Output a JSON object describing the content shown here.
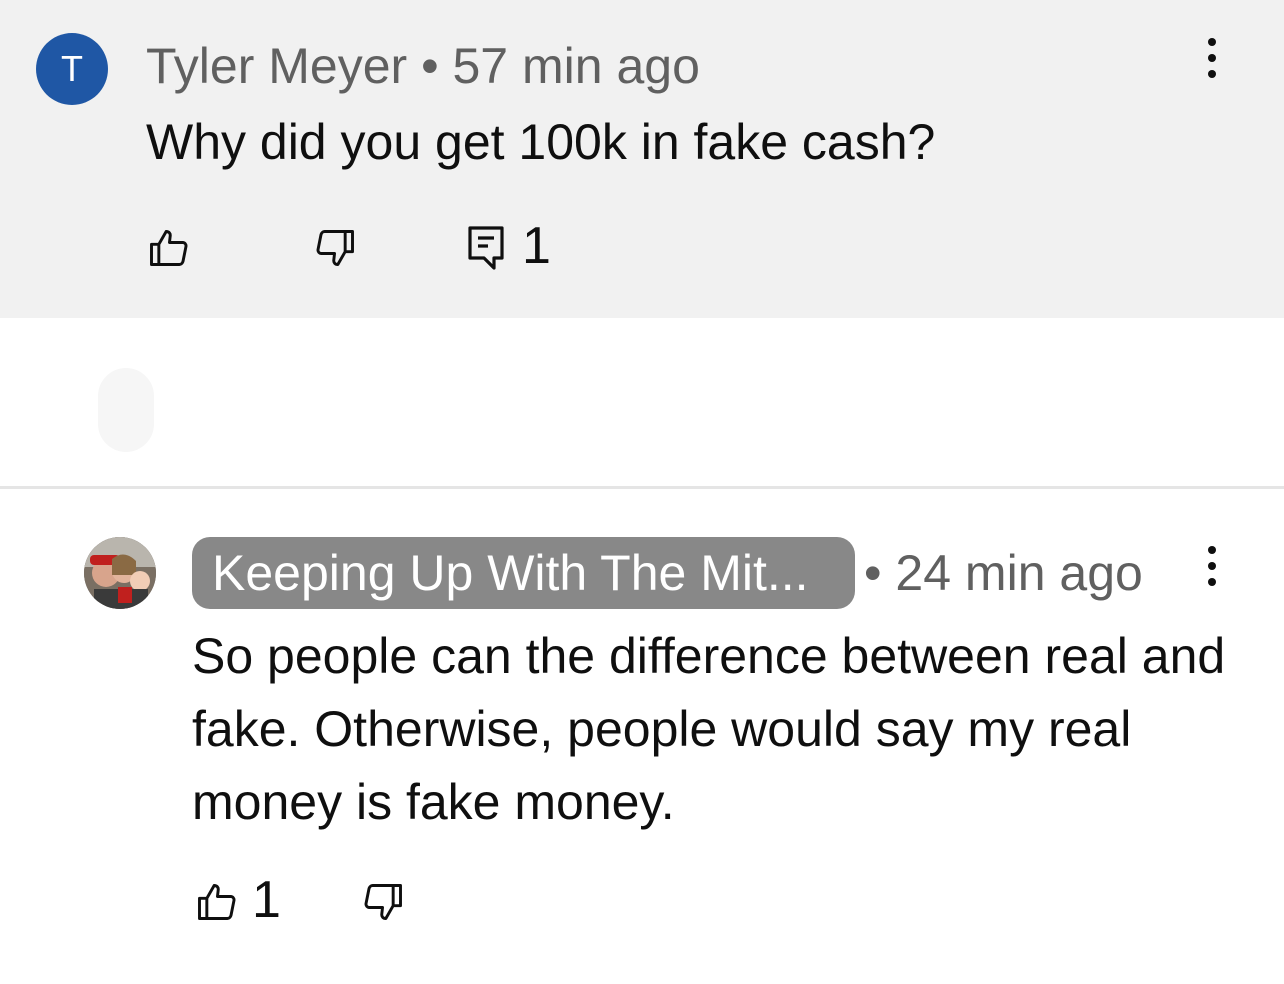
{
  "comment": {
    "avatar_letter": "T",
    "avatar_color": "#1f57a5",
    "author": "Tyler Meyer",
    "separator": "•",
    "time": "57 min ago",
    "text": "Why did you get 100k in fake cash?",
    "reply_count": "1",
    "background": "#f1f1f1",
    "icons": {
      "like": "thumbs-up-icon",
      "dislike": "thumbs-down-icon",
      "replies": "comment-icon",
      "menu": "more-vert-icon"
    }
  },
  "reply": {
    "author": "Keeping Up With The Mit...",
    "separator": "•",
    "time": "24 min ago",
    "text": "So people can the difference between real and fake. Otherwise, people would say my real money is fake money.",
    "like_count": "1",
    "author_badge_color": "#888888",
    "icons": {
      "avatar": "family-photo-avatar",
      "like": "thumbs-up-icon",
      "dislike": "thumbs-down-icon",
      "menu": "more-vert-icon"
    }
  }
}
